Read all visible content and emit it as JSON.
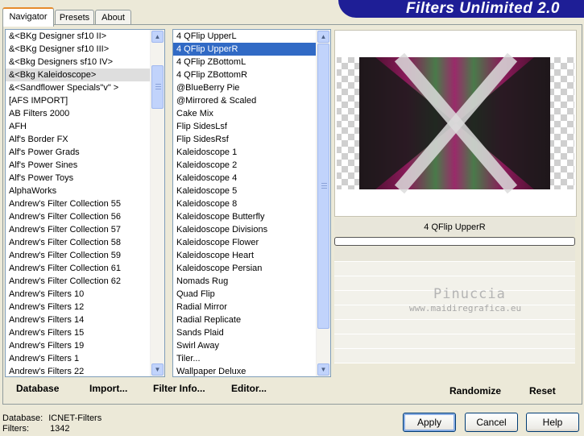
{
  "app": {
    "brand": "Filters Unlimited 2.0",
    "tabs": [
      {
        "label": "Navigator",
        "active": true
      },
      {
        "label": "Presets",
        "active": false
      },
      {
        "label": "About",
        "active": false
      }
    ]
  },
  "categories": {
    "selected": "&<Bkg Kaleidoscope>",
    "items": [
      "&<BKg Designer sf10 II>",
      "&<BKg Designer sf10 III>",
      "&<Bkg Designers sf10 IV>",
      "&<Bkg Kaleidoscope>",
      "&<Sandflower Specials\"v\" >",
      "[AFS IMPORT]",
      "AB Filters 2000",
      "AFH",
      "Alf's Border FX",
      "Alf's Power Grads",
      "Alf's Power Sines",
      "Alf's Power Toys",
      "AlphaWorks",
      "Andrew's Filter Collection 55",
      "Andrew's Filter Collection 56",
      "Andrew's Filter Collection 57",
      "Andrew's Filter Collection 58",
      "Andrew's Filter Collection 59",
      "Andrew's Filter Collection 61",
      "Andrew's Filter Collection 62",
      "Andrew's Filters 10",
      "Andrew's Filters 12",
      "Andrew's Filters 14",
      "Andrew's Filters 15",
      "Andrew's Filters 19",
      "Andrew's Filters 1",
      "Andrew's Filters 22"
    ]
  },
  "filters": {
    "selected": "4 QFlip UpperR",
    "items": [
      "4 QFlip UpperL",
      "4 QFlip UpperR",
      "4 QFlip ZBottomL",
      "4 QFlip ZBottomR",
      "@BlueBerry Pie",
      "@Mirrored & Scaled",
      "Cake Mix",
      "Flip SidesLsf",
      "Flip SidesRsf",
      "Kaleidoscope 1",
      "Kaleidoscope 2",
      "Kaleidoscope 4",
      "Kaleidoscope 5",
      "Kaleidoscope 8",
      "Kaleidoscope Butterfly",
      "Kaleidoscope Divisions",
      "Kaleidoscope Flower",
      "Kaleidoscope Heart",
      "Kaleidoscope Persian",
      "Nomads Rug",
      "Quad Flip",
      "Radial Mirror",
      "Radial Replicate",
      "Sands Plaid",
      "Swirl Away",
      "Tiler...",
      "Wallpaper Deluxe"
    ]
  },
  "toolbar": {
    "database": "Database",
    "import": "Import...",
    "filter_info": "Filter Info...",
    "editor": "Editor..."
  },
  "preview": {
    "filter_name": "4 QFlip UpperR",
    "watermark_name": "Pinuccia",
    "watermark_url": "www.maidiregrafica.eu",
    "colors": {
      "magenta": "#8a1a5a",
      "green": "#4a7a4a",
      "dark": "#111111"
    }
  },
  "param_buttons": {
    "randomize": "Randomize",
    "reset": "Reset"
  },
  "footer": {
    "database_label": "Database:",
    "database_value": "ICNET-Filters",
    "filters_label": "Filters:",
    "filters_value": "1342",
    "apply": "Apply",
    "cancel": "Cancel",
    "help": "Help"
  }
}
